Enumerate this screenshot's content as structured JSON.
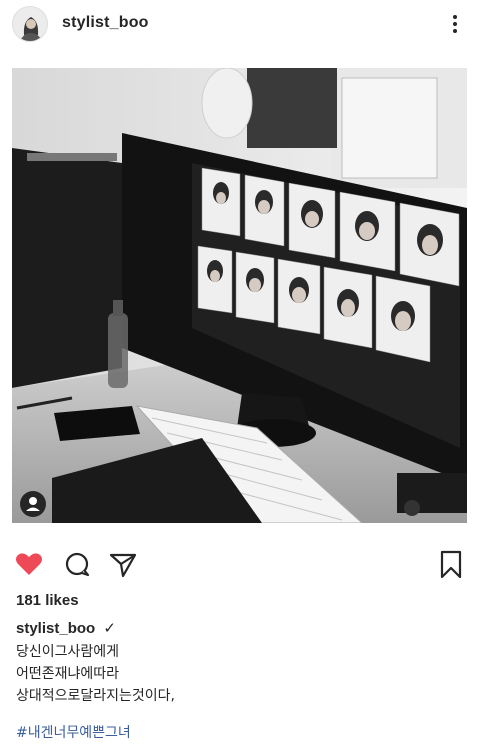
{
  "post": {
    "username": "stylist_boo",
    "verified_mark": "✓",
    "likes_text": "181 likes",
    "caption_lines": [
      "당신이그사람에게",
      "어떤존재냐에따라",
      "상대적으로달라지는것이다,"
    ],
    "hashtag": "#내겐너무예쁜그녀",
    "liked": true
  },
  "icons": {
    "avatar": "profile-avatar",
    "more": "more-dots-icon",
    "heart": "heart-icon",
    "comment": "comment-icon",
    "share": "send-icon",
    "save": "bookmark-icon",
    "user_tag": "user-tag-icon"
  },
  "colors": {
    "heart": "#ed4956",
    "hashtag": "#3b5f9a",
    "text": "#262626"
  }
}
